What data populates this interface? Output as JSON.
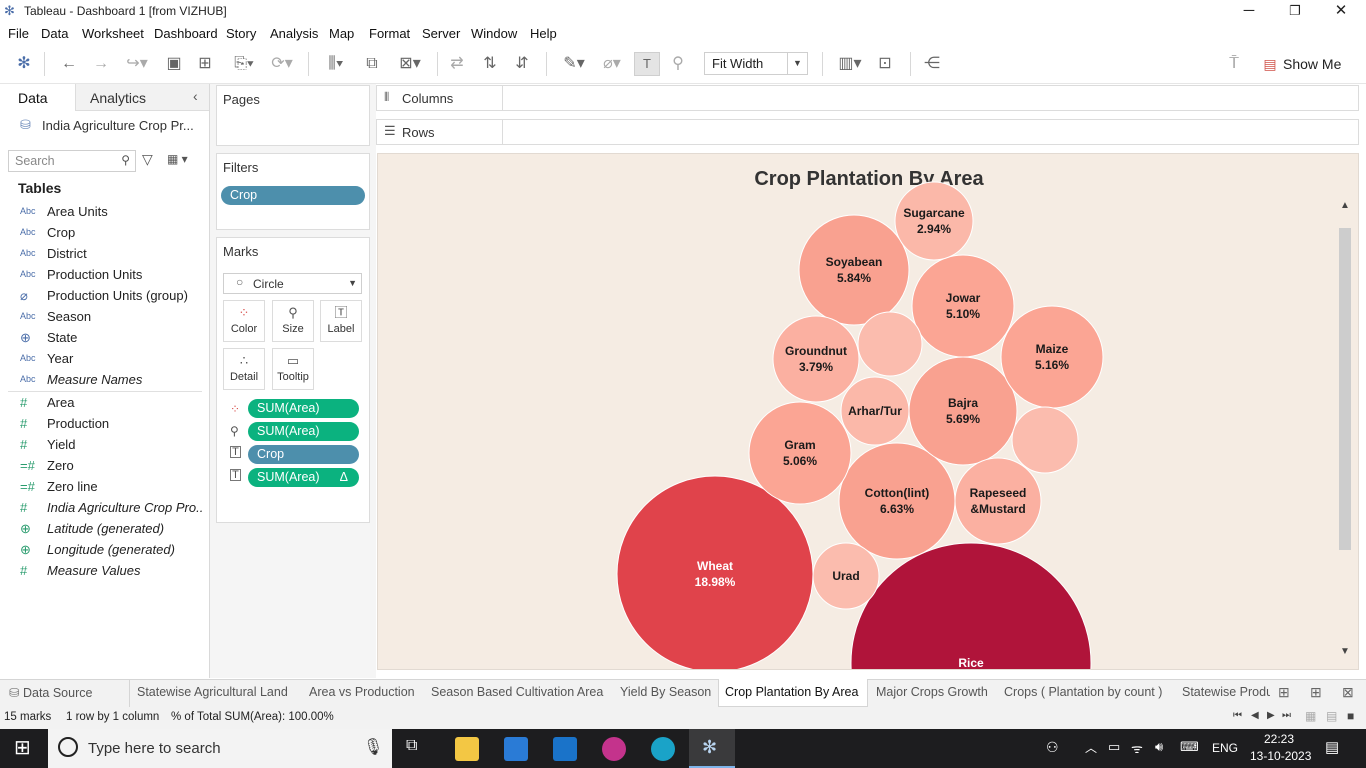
{
  "window": {
    "title": "Tableau - Dashboard 1 [from VIZHUB]",
    "minimize": "─",
    "restore": "❐",
    "close": "✕"
  },
  "menu": [
    "File",
    "Data",
    "Worksheet",
    "Dashboard",
    "Story",
    "Analysis",
    "Map",
    "Format",
    "Server",
    "Window",
    "Help"
  ],
  "toolbar": {
    "fit_label": "Fit Width",
    "show_me": "Show Me"
  },
  "left_pane": {
    "tab_data": "Data",
    "tab_analytics": "Analytics",
    "datasource": "India Agriculture Crop Pr...",
    "search_placeholder": "Search",
    "tables_heading": "Tables",
    "dimensions": [
      {
        "icon": "Abc",
        "name": "Area Units",
        "italic": false
      },
      {
        "icon": "Abc",
        "name": "Crop",
        "italic": false
      },
      {
        "icon": "Abc",
        "name": "District",
        "italic": false
      },
      {
        "icon": "Abc",
        "name": "Production Units",
        "italic": false
      },
      {
        "icon": "⌀",
        "name": "Production Units (group)",
        "italic": false
      },
      {
        "icon": "Abc",
        "name": "Season",
        "italic": false
      },
      {
        "icon": "⊕",
        "name": "State",
        "italic": false
      },
      {
        "icon": "Abc",
        "name": "Year",
        "italic": false
      },
      {
        "icon": "Abc",
        "name": "Measure Names",
        "italic": true
      }
    ],
    "measures": [
      {
        "icon": "#",
        "name": "Area",
        "italic": false
      },
      {
        "icon": "#",
        "name": "Production",
        "italic": false
      },
      {
        "icon": "#",
        "name": "Yield",
        "italic": false
      },
      {
        "icon": "=#",
        "name": "Zero",
        "italic": false
      },
      {
        "icon": "=#",
        "name": "Zero line",
        "italic": false
      },
      {
        "icon": "#",
        "name": "India Agriculture Crop Pro...",
        "italic": true
      },
      {
        "icon": "⊕",
        "name": "Latitude (generated)",
        "italic": true
      },
      {
        "icon": "⊕",
        "name": "Longitude (generated)",
        "italic": true
      },
      {
        "icon": "#",
        "name": "Measure Values",
        "italic": true
      }
    ]
  },
  "cards": {
    "pages": "Pages",
    "filters": "Filters",
    "filter_pill": "Crop",
    "marks": "Marks",
    "mark_type": "Circle",
    "mark_buttons": {
      "color": "Color",
      "size": "Size",
      "label": "Label",
      "detail": "Detail",
      "tooltip": "Tooltip"
    },
    "mark_pills": [
      {
        "label": "SUM(Area)",
        "kind": "green",
        "icon": "color",
        "delta": ""
      },
      {
        "label": "SUM(Area)",
        "kind": "green",
        "icon": "size",
        "delta": ""
      },
      {
        "label": "Crop",
        "kind": "blue",
        "icon": "label",
        "delta": ""
      },
      {
        "label": "SUM(Area)",
        "kind": "green",
        "icon": "label",
        "delta": "Δ"
      }
    ]
  },
  "shelves": {
    "columns": "Columns",
    "rows": "Rows"
  },
  "chart_data": {
    "type": "bubble",
    "title": "Crop Plantation By Area",
    "measure": "% of Total SUM(Area)",
    "series": [
      {
        "name": "Rice",
        "percent": null,
        "label": "Rice",
        "pct_text": "",
        "color": "#b0143a"
      },
      {
        "name": "Wheat",
        "percent": 18.98,
        "label": "Wheat",
        "pct_text": "18.98%",
        "color": "#e0434b"
      },
      {
        "name": "Cotton(lint)",
        "percent": 6.63,
        "label": "Cotton(lint)",
        "pct_text": "6.63%",
        "color": "#f9a190"
      },
      {
        "name": "Soyabean",
        "percent": 5.84,
        "label": "Soyabean",
        "pct_text": "5.84%",
        "color": "#f9a190"
      },
      {
        "name": "Bajra",
        "percent": 5.69,
        "label": "Bajra",
        "pct_text": "5.69%",
        "color": "#f9a190"
      },
      {
        "name": "Maize",
        "percent": 5.16,
        "label": "Maize",
        "pct_text": "5.16%",
        "color": "#fba594"
      },
      {
        "name": "Jowar",
        "percent": 5.1,
        "label": "Jowar",
        "pct_text": "5.10%",
        "color": "#fba594"
      },
      {
        "name": "Gram",
        "percent": 5.06,
        "label": "Gram",
        "pct_text": "5.06%",
        "color": "#fba594"
      },
      {
        "name": "Groundnut",
        "percent": 3.79,
        "label": "Groundnut",
        "pct_text": "3.79%",
        "color": "#fbb0a1"
      },
      {
        "name": "Rapeseed &Mustard",
        "percent": null,
        "label": "Rapeseed\n&Mustard",
        "pct_text": "",
        "color": "#fbb0a1"
      },
      {
        "name": "Sugarcane",
        "percent": 2.94,
        "label": "Sugarcane",
        "pct_text": "2.94%",
        "color": "#fbb8a9"
      },
      {
        "name": "Arhar/Tur",
        "percent": null,
        "label": "Arhar/Tur",
        "pct_text": "",
        "color": "#fbb8a9"
      },
      {
        "name": "Urad",
        "percent": null,
        "label": "Urad",
        "pct_text": "",
        "color": "#fbbcae"
      },
      {
        "name": "(unlabeled 1)",
        "percent": null,
        "label": "",
        "pct_text": "",
        "color": "#fbbcae"
      },
      {
        "name": "(unlabeled 2)",
        "percent": null,
        "label": "",
        "pct_text": "",
        "color": "#fbbcae"
      }
    ]
  },
  "sheet_tabs": [
    {
      "label": "Data Source",
      "active": false
    },
    {
      "label": "Statewise Agricultural Land",
      "active": false
    },
    {
      "label": "Area vs Production",
      "active": false
    },
    {
      "label": "Season Based Cultivation Area",
      "active": false
    },
    {
      "label": "Yield By Season",
      "active": false
    },
    {
      "label": "Crop Plantation By Area",
      "active": true
    },
    {
      "label": "Major Crops Growth",
      "active": false
    },
    {
      "label": "Crops ( Plantation by count )",
      "active": false
    },
    {
      "label": "Statewise Produ",
      "active": false
    }
  ],
  "status": {
    "marks": "15 marks",
    "dims": "1 row by 1 column",
    "total": "% of Total SUM(Area): 100.00%"
  },
  "taskbar": {
    "search_placeholder": "Type here to search",
    "language": "ENG",
    "time": "22:23",
    "date": "13-10-2023"
  }
}
